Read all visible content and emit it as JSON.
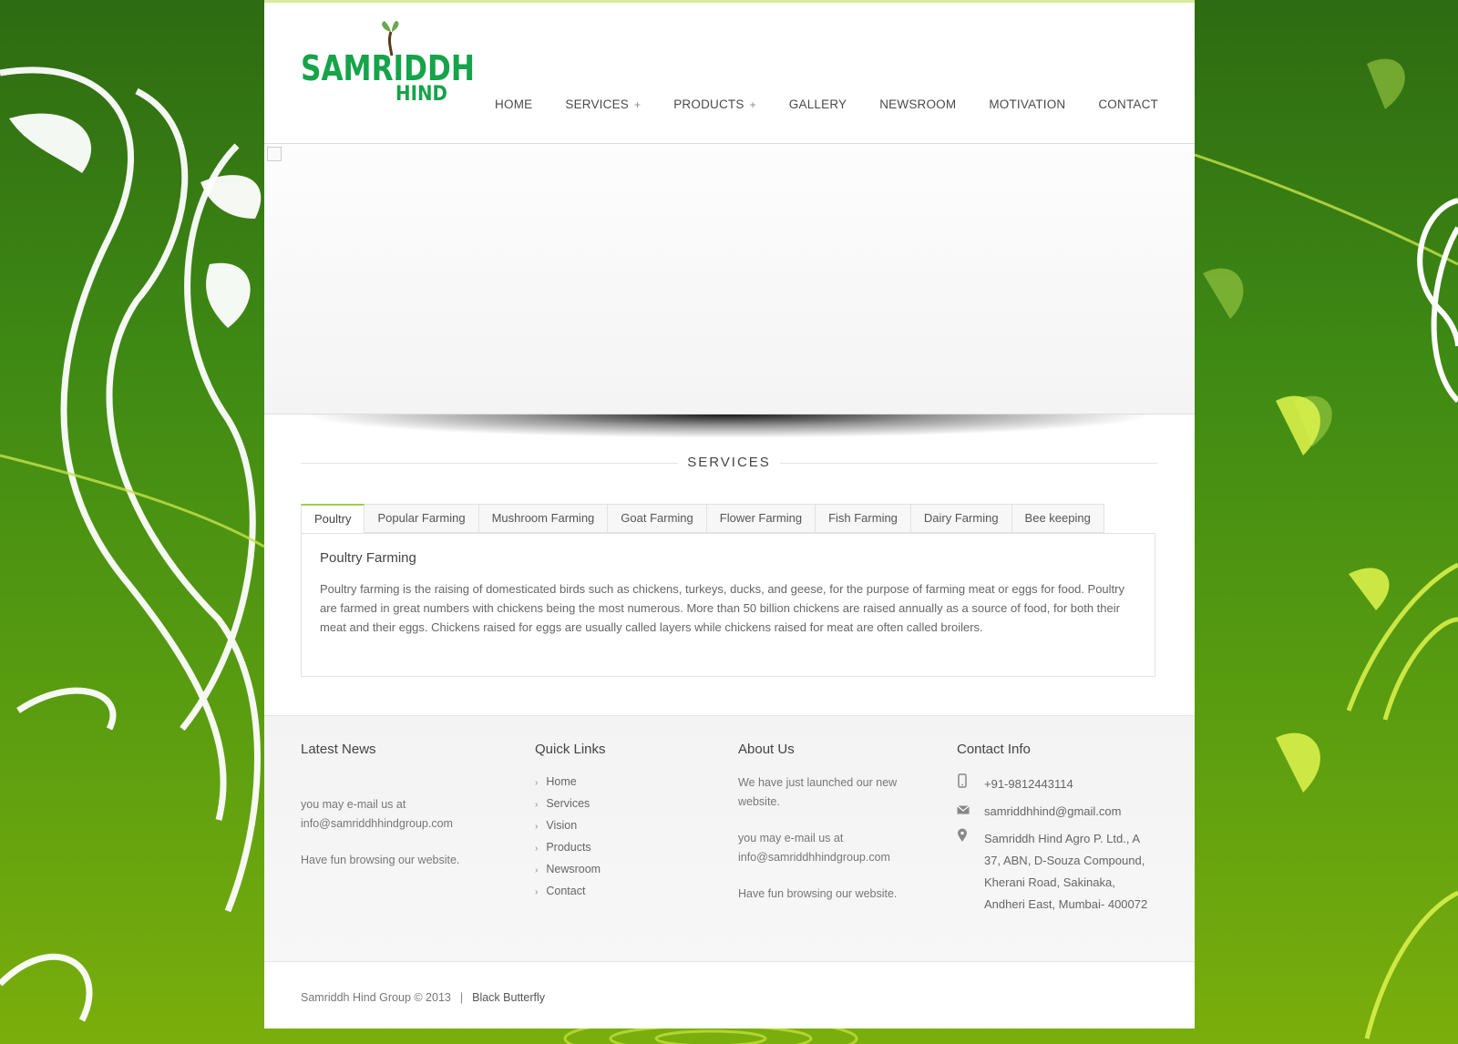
{
  "brand": {
    "logo_top": "SAMRIDDH",
    "logo_bottom": "HIND"
  },
  "nav": [
    {
      "label": "HOME",
      "has_sub": false
    },
    {
      "label": "SERVICES",
      "has_sub": true
    },
    {
      "label": "PRODUCTS",
      "has_sub": true
    },
    {
      "label": "GALLERY",
      "has_sub": false
    },
    {
      "label": "NEWSROOM",
      "has_sub": false
    },
    {
      "label": "MOTIVATION",
      "has_sub": false
    },
    {
      "label": "CONTACT",
      "has_sub": false
    }
  ],
  "nav_sub_indicator": "+",
  "section_title": "SERVICES",
  "tabs": [
    "Poultry",
    "Popular Farming",
    "Mushroom Farming",
    "Goat Farming",
    "Flower Farming",
    "Fish Farming",
    "Dairy Farming",
    "Bee keeping"
  ],
  "active_tab": {
    "heading": "Poultry Farming",
    "body": "Poultry farming is the raising of domesticated birds such as chickens, turkeys, ducks, and geese, for the purpose of farming meat or eggs for food. Poultry are farmed in great numbers with chickens being the most numerous. More than 50 billion chickens are raised annually as a source of food, for both their meat and their eggs. Chickens raised for eggs are usually called layers while chickens raised for meat are often called broilers."
  },
  "footer": {
    "latest_news": {
      "title": "Latest News",
      "line1": "you may e-mail us at",
      "line2": "info@samriddhhindgroup.com",
      "line3": "Have fun browsing our website."
    },
    "quick_links": {
      "title": "Quick Links",
      "items": [
        "Home",
        "Services",
        "Vision",
        "Products",
        "Newsroom",
        "Contact"
      ]
    },
    "about": {
      "title": "About Us",
      "line1": "We have just launched our new",
      "line2": "website.",
      "line3": "you may e-mail us at",
      "line4": "info@samriddhhindgroup.com",
      "line5": "Have fun browsing our website."
    },
    "contact": {
      "title": "Contact Info",
      "phone": "+91-9812443114",
      "email": "samriddhhind@gmail.com",
      "address_lines": [
        "Samriddh Hind Agro P. Ltd., A",
        "37, ABN, D-Souza Compound,",
        "Kherani Road, Sakinaka,",
        "Andheri East, Mumbai- 400072"
      ]
    }
  },
  "copyright": "Samriddh Hind Group © 2013",
  "copyright_sep": "|",
  "credit": "Black Butterfly",
  "colors": {
    "brand_green": "#16a34a",
    "tab_accent": "#9bd14a",
    "bg_green": "#3f8a14"
  }
}
